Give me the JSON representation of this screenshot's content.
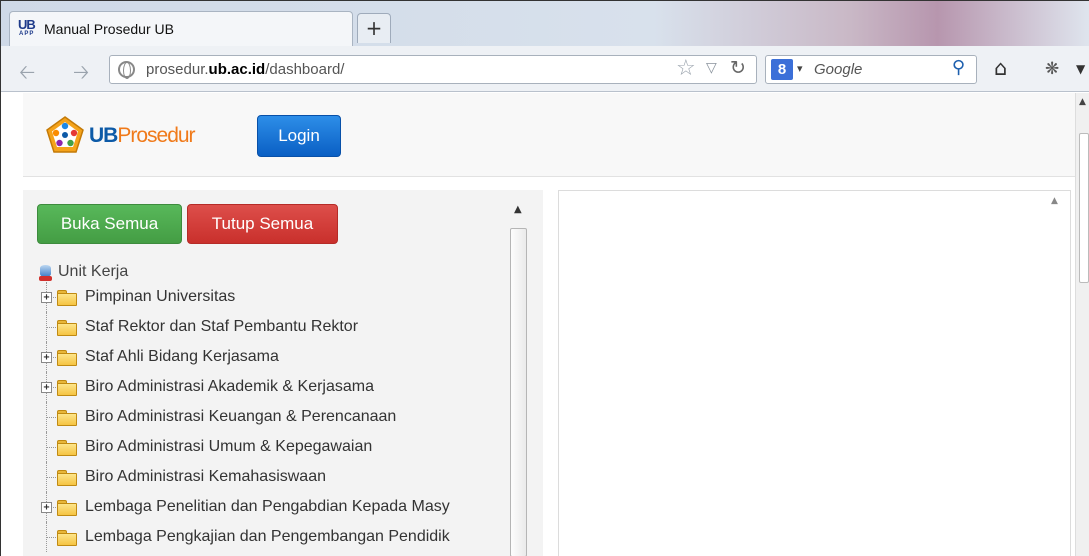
{
  "browser": {
    "tab_title": "Manual Prosedur UB",
    "favicon_text_top": "UB",
    "favicon_text_bottom": "APP",
    "new_tab_label": "+",
    "url_prefix": "prosedur.",
    "url_domain": "ub.ac.id",
    "url_path": "/dashboard/",
    "search_engine_letter": "8",
    "search_placeholder": "Google",
    "icons": {
      "back": "back-arrow-icon",
      "forward": "forward-arrow-icon",
      "site": "globe-icon",
      "bookmark": "star-icon",
      "reload": "reload-icon",
      "search": "magnifier-icon",
      "home": "home-icon"
    }
  },
  "header": {
    "brand_part1": "UB",
    "brand_part2": "Prosedur",
    "login_label": "Login",
    "colors": {
      "brand_blue": "#0d5aa7",
      "brand_orange": "#f07a1a",
      "login_bg": "#1b73d4"
    }
  },
  "left_panel": {
    "open_all_label": "Buka Semua",
    "close_all_label": "Tutup Semua",
    "colors": {
      "open_all": "#4cae4c",
      "close_all": "#d9534f"
    },
    "tree_root": "Unit Kerja",
    "tree_items": [
      {
        "label": "Pimpinan Universitas",
        "expandable": true
      },
      {
        "label": "Staf Rektor dan Staf Pembantu Rektor",
        "expandable": false
      },
      {
        "label": "Staf Ahli Bidang Kerjasama",
        "expandable": true
      },
      {
        "label": "Biro Administrasi Akademik & Kerjasama",
        "expandable": true
      },
      {
        "label": "Biro Administrasi Keuangan & Perencanaan",
        "expandable": false
      },
      {
        "label": "Biro Administrasi Umum & Kepegawaian",
        "expandable": false
      },
      {
        "label": "Biro Administrasi Kemahasiswaan",
        "expandable": false
      },
      {
        "label": "Lembaga Penelitian dan Pengabdian Kepada Masy",
        "expandable": true
      },
      {
        "label": "Lembaga Pengkajian dan Pengembangan Pendidik",
        "expandable": false
      }
    ]
  }
}
